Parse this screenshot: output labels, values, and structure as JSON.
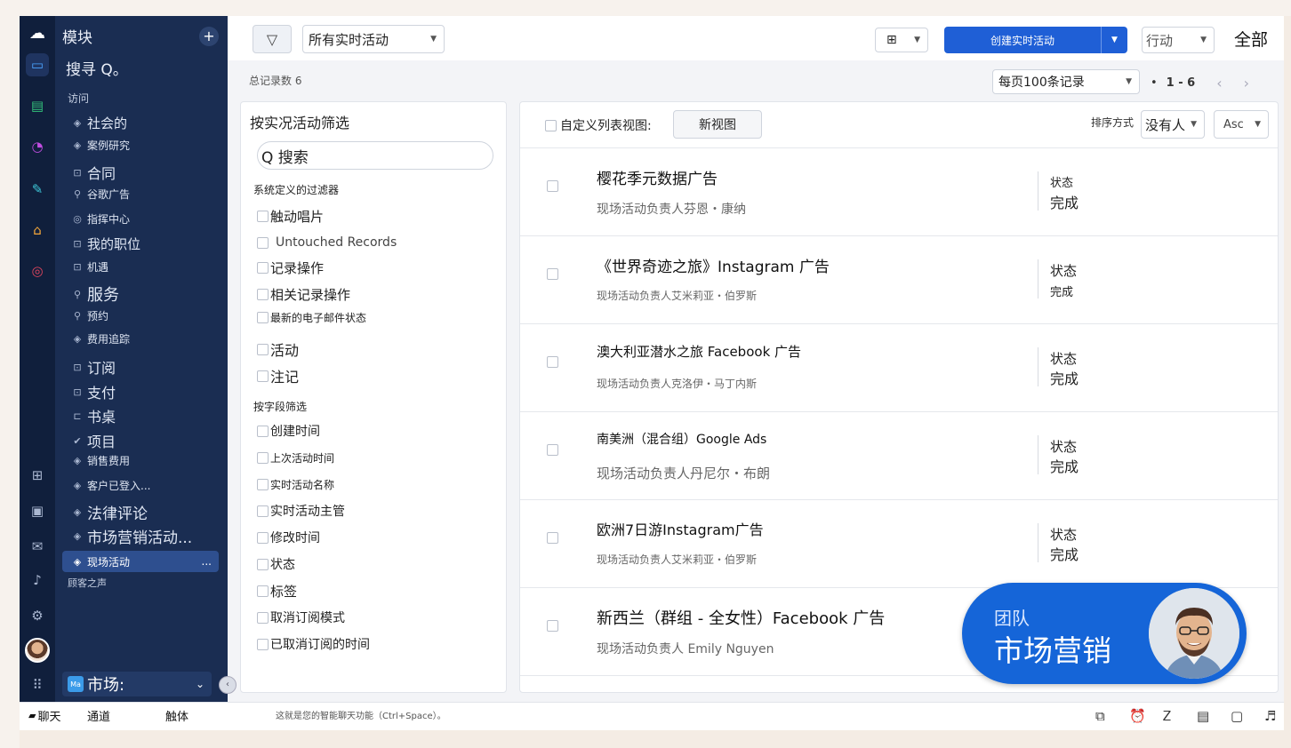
{
  "sidebar": {
    "header": "模块",
    "search": "搜寻 Q。",
    "section_visit": "访问",
    "items": [
      {
        "icon": "diamond-icon",
        "label": "社会的"
      },
      {
        "icon": "diamond-icon",
        "label": "案例研究"
      },
      {
        "icon": "record-icon",
        "label": "合同"
      },
      {
        "icon": "people-icon",
        "label": "谷歌广告"
      },
      {
        "icon": "target-icon",
        "label": "指挥中心"
      },
      {
        "icon": "record-icon",
        "label": "我的职位"
      },
      {
        "icon": "record-icon",
        "label": "机遇"
      },
      {
        "icon": "people-icon",
        "label": "服务"
      },
      {
        "icon": "people-icon",
        "label": "预约"
      },
      {
        "icon": "diamond-icon",
        "label": "费用追踪"
      },
      {
        "icon": "record-icon",
        "label": "订阅"
      },
      {
        "icon": "record-icon",
        "label": "支付"
      },
      {
        "icon": "desk-icon",
        "label": "书桌"
      },
      {
        "icon": "check-icon",
        "label": "项目"
      },
      {
        "icon": "diamond-icon",
        "label": "销售费用"
      },
      {
        "icon": "diamond-icon",
        "label": "客户已登入..."
      },
      {
        "icon": "diamond-icon",
        "label": "法律评论"
      },
      {
        "icon": "diamond-icon",
        "label": "市场营销活动..."
      },
      {
        "icon": "diamond-icon",
        "label": "现场活动"
      }
    ],
    "section_voice": "顾客之声",
    "more": "...",
    "market_badge": "Ma",
    "market_label": "市场:",
    "collapse": "‹"
  },
  "topbar": {
    "view_select": "所有实时活动",
    "create_button": "创建实时活动",
    "action_button": "行动",
    "all_label": "全部"
  },
  "subbar": {
    "total": "总记录数 6",
    "per_page": "每页100条记录",
    "pager_dot": "•",
    "range": "1 - 6"
  },
  "filters": {
    "title": "按实况活动筛选",
    "search": "Q 搜索",
    "system_section": "系统定义的过滤器",
    "system": [
      "触动唱片",
      "Untouched Records",
      "记录操作",
      "相关记录操作",
      "最新的电子邮件状态",
      "活动",
      "注记"
    ],
    "field_section": "按字段筛选",
    "fields": [
      "创建时间",
      "上次活动时间",
      "实时活动名称",
      "实时活动主管",
      "修改时间",
      "状态",
      "标签",
      "取消订阅模式",
      "已取消订阅的时间"
    ]
  },
  "list": {
    "custom_view": "自定义列表视图:",
    "new_view": "新视图",
    "sort_label": "排序方式",
    "sort_value": "没有人",
    "order_value": "Asc",
    "rows": [
      {
        "title": "樱花季元数据广告",
        "owner": "现场活动负责人芬恩・康纳",
        "status_label": "状态",
        "status": "完成"
      },
      {
        "title": "《世界奇迹之旅》Instagram 广告",
        "owner": "现场活动负责人艾米莉亚・伯罗斯",
        "status_label": "状态",
        "status": "完成"
      },
      {
        "title": "澳大利亚潜水之旅 Facebook 广告",
        "owner": "现场活动负责人克洛伊・马丁内斯",
        "status_label": "状态",
        "status": "完成"
      },
      {
        "title": "南美洲（混合组）Google Ads",
        "owner": "现场活动负责人丹尼尔・布朗",
        "status_label": "状态",
        "status": "完成"
      },
      {
        "title": "欧洲7日游Instagram广告",
        "owner": "现场活动负责人艾米莉亚・伯罗斯",
        "status_label": "状态",
        "status": "完成"
      },
      {
        "title": "新西兰（群组 - 全女性）Facebook 广告",
        "owner": "现场活动负责人 Emily Nguyen",
        "status_label": "",
        "status": ""
      }
    ]
  },
  "team_card": {
    "label": "团队",
    "name": "市场营销"
  },
  "bottom": {
    "chat": "聊天",
    "channel": "通道",
    "contact": "触体",
    "hint": "这就是您的智能聊天功能（Ctrl+Space）。"
  },
  "colors": {
    "sidebar": "#1a2d52",
    "rail": "#101f3c",
    "accent": "#1f5fd6",
    "team_card": "#1565d8"
  }
}
